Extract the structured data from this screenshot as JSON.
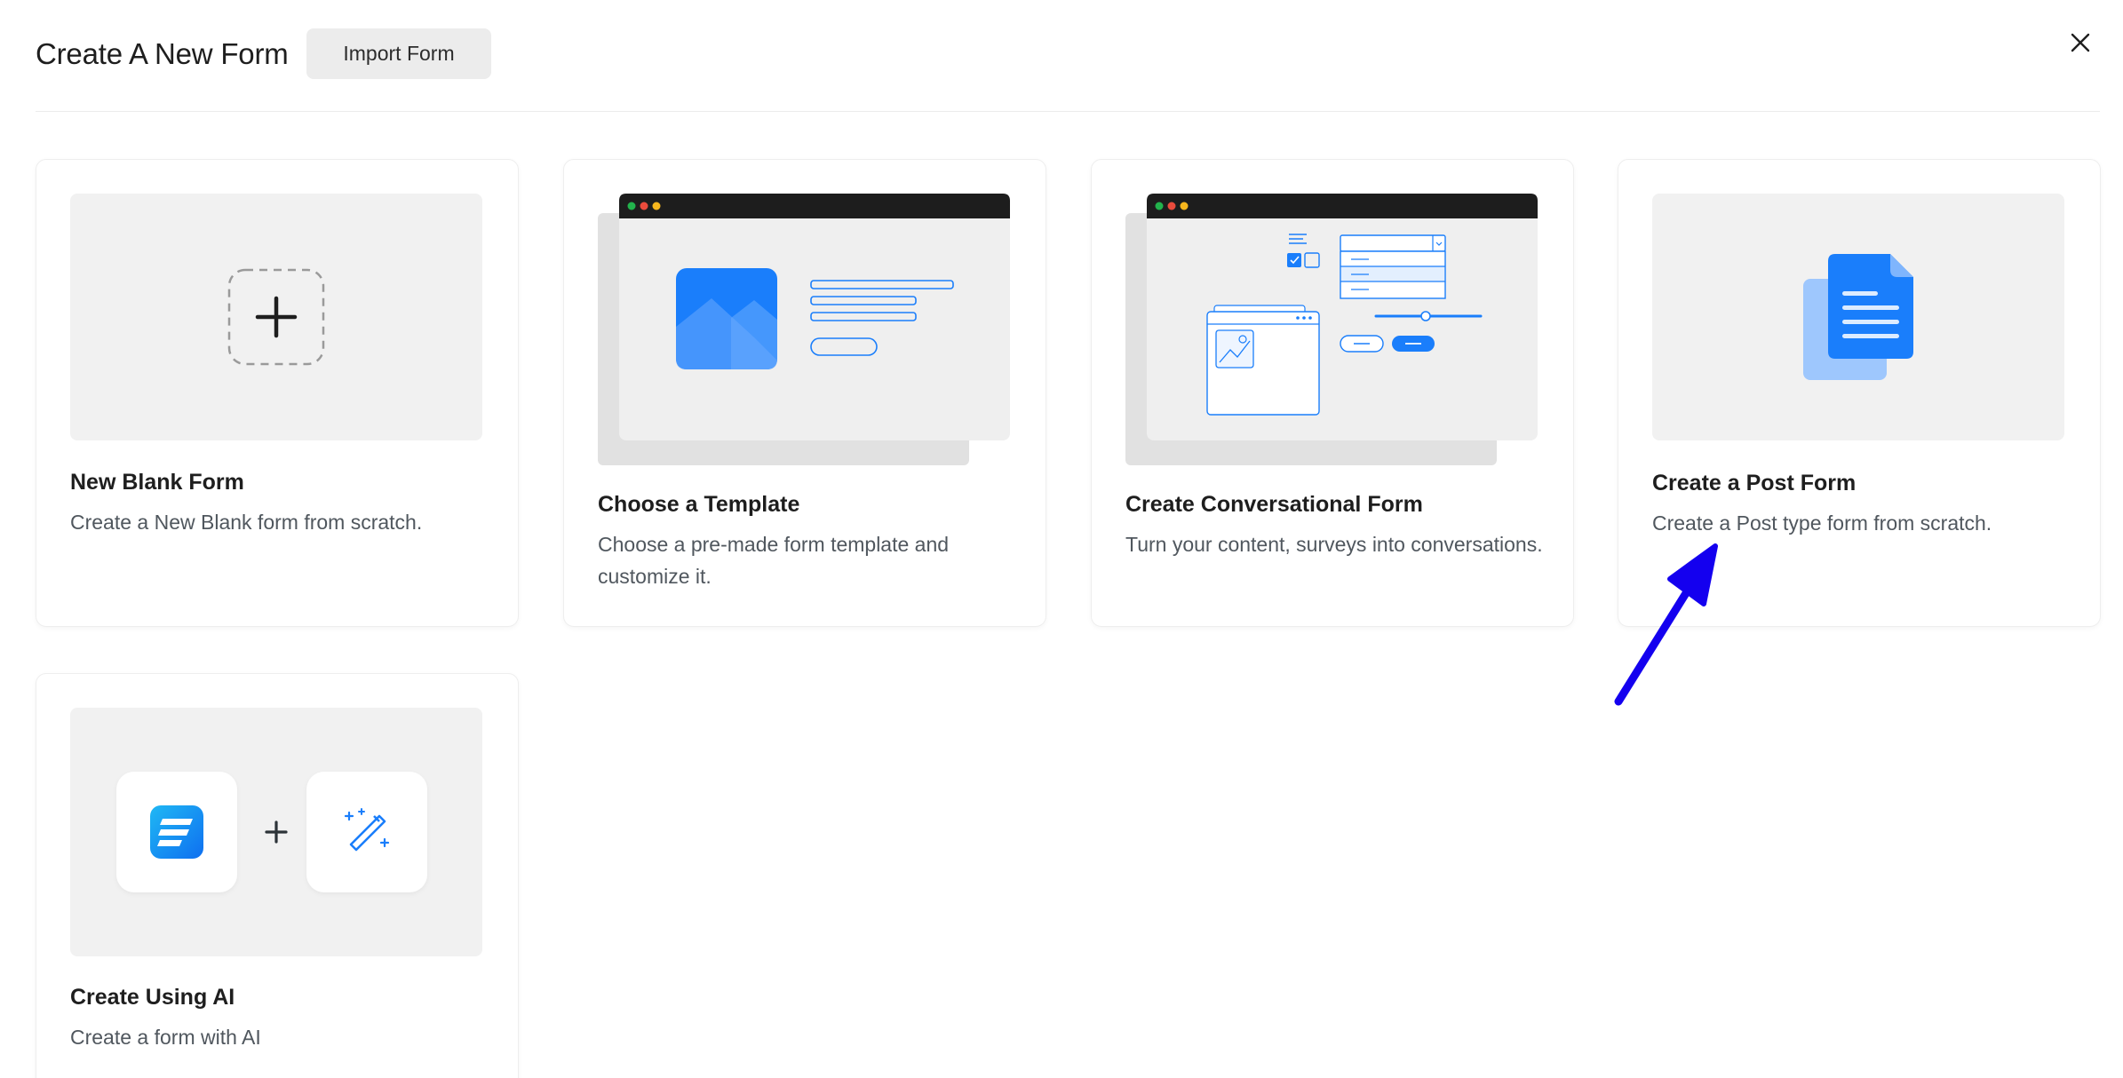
{
  "header": {
    "title": "Create A New Form",
    "import_label": "Import Form"
  },
  "cards": [
    {
      "title": "New Blank Form",
      "desc": "Create a New Blank form from scratch."
    },
    {
      "title": "Choose a Template",
      "desc": "Choose a pre-made form template and customize it."
    },
    {
      "title": "Create Conversational Form",
      "desc": "Turn your content, surveys into conversations."
    },
    {
      "title": "Create a Post Form",
      "desc": "Create a Post type form from scratch."
    },
    {
      "title": "Create Using AI",
      "desc": "Create a form with AI"
    }
  ],
  "colors": {
    "accent": "#1a7efb",
    "arrow": "#1400ef",
    "window_bar": "#1d1d1d"
  }
}
